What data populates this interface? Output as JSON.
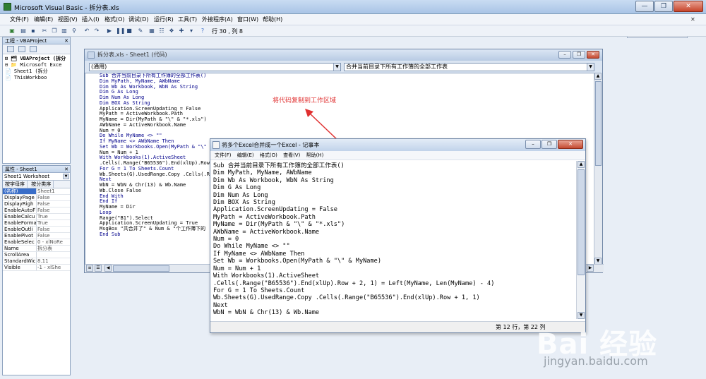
{
  "app": {
    "title": "Microsoft Visual Basic - 拆分表.xls",
    "window_buttons": [
      "—",
      "❐",
      "✕"
    ]
  },
  "menu": {
    "items": [
      "文件(F)",
      "编辑(E)",
      "视图(V)",
      "插入(I)",
      "格式(O)",
      "调试(D)",
      "运行(R)",
      "工具(T)",
      "外接程序(A)",
      "窗口(W)",
      "帮助(H)"
    ],
    "help_placeholder": "键入需要帮助的问题"
  },
  "toolbar": {
    "position": "行 30 , 列 8"
  },
  "project_pane": {
    "title": "工程 - VBAProject",
    "tree": [
      "⊟ 🗂 VBAProject (拆分",
      "  ⊟ 📁 Microsoft Exce",
      "      📄 Sheet1 (拆分",
      "      📄 ThisWorkboo"
    ]
  },
  "properties_pane": {
    "title": "属性 - Sheet1",
    "object": "Sheet1 Worksheet",
    "tabs": [
      "按字母序",
      "按分类序"
    ],
    "rows": [
      {
        "k": "(名称)",
        "v": "Sheet1"
      },
      {
        "k": "DisplayPage",
        "v": "False"
      },
      {
        "k": "DisplayRigh",
        "v": "False"
      },
      {
        "k": "EnableAutoF",
        "v": "False"
      },
      {
        "k": "EnableCalcu",
        "v": "True"
      },
      {
        "k": "EnableForma",
        "v": "True"
      },
      {
        "k": "EnableOutli",
        "v": "False"
      },
      {
        "k": "EnablePivot",
        "v": "False"
      },
      {
        "k": "EnableSelec",
        "v": "0 - xlNoRe"
      },
      {
        "k": "Name",
        "v": "拆分表"
      },
      {
        "k": "ScrollArea",
        "v": ""
      },
      {
        "k": "StandardWic",
        "v": "8.11"
      },
      {
        "k": "Visible",
        "v": "-1 - xlShe"
      }
    ]
  },
  "code_window": {
    "title": "拆分表.xls - Sheet1 (代码)",
    "object_combo": "(通用)",
    "proc_combo": "合并当前目录下所有工作簿的全部工作表",
    "lines": [
      "Sub 合并当前目录下所有工作簿的全部工作表()",
      "Dim MyPath, MyName, AWbName",
      "Dim Wb As Workbook, WbN As String",
      "Dim G As Long",
      "Dim Num As Long",
      "Dim BOX As String",
      "Application.ScreenUpdating = False",
      "MyPath = ActiveWorkbook.Path",
      "MyName = Dir(MyPath & \"\\\" & \"*.xls\")",
      "AWbName = ActiveWorkbook.Name",
      "Num = 0",
      "Do While MyName <> \"\"",
      "If MyName <> AWbName Then",
      "Set Wb = Workbooks.Open(MyPath & \"\\\" &",
      "Num = Num + 1",
      "With Workbooks(1).ActiveSheet",
      ".Cells(.Range(\"B65536\").End(xlUp).Row",
      "For G = 1 To Sheets.Count",
      "Wb.Sheets(G).UsedRange.Copy .Cells(.R",
      "Next",
      "WbN = WbN & Chr(13) & Wb.Name",
      "Wb.Close False",
      "End With",
      "End If",
      "MyName = Dir",
      "Loop",
      "Range(\"B1\").Select",
      "Application.ScreenUpdating = True",
      "MsgBox \"共合并了\" & Num & \"个工作薄下的",
      "End Sub"
    ]
  },
  "annotation": "将代码复制到工作区域",
  "notepad": {
    "title": "将多个Excel合并成一个Excel - 记事本",
    "menu": [
      "文件(F)",
      "编辑(E)",
      "格式(O)",
      "查看(V)",
      "帮助(H)"
    ],
    "lines": [
      "Sub 合并当前目录下所有工作簿的全部工作表()",
      "Dim MyPath, MyName, AWbName",
      "Dim Wb As Workbook, WbN As String",
      "Dim G As Long",
      "Dim Num As Long",
      "Dim BOX As String",
      "Application.ScreenUpdating = False",
      "MyPath = ActiveWorkbook.Path",
      "MyName = Dir(MyPath & \"\\\" & \"*.xls\")",
      "AWbName = ActiveWorkbook.Name",
      "Num = 0",
      "Do While MyName <> \"\"",
      "If MyName <> AWbName Then",
      "Set Wb = Workbooks.Open(MyPath & \"\\\" & MyName)",
      "Num = Num + 1",
      "With Workbooks(1).ActiveSheet",
      ".Cells(.Range(\"B65536\").End(xlUp).Row + 2, 1) = Left(MyName, Len(MyName) - 4)",
      "For G = 1 To Sheets.Count",
      "Wb.Sheets(G).UsedRange.Copy .Cells(.Range(\"B65536\").End(xlUp).Row + 1, 1)",
      "Next",
      "WbN = WbN & Chr(13) & Wb.Name"
    ],
    "status": "第 12 行，第 22 列"
  },
  "watermark": {
    "logo": "Bai 经验",
    "url": "jingyan.baidu.com"
  },
  "colors": {
    "keyword": "#00008b",
    "annotation": "#e03030",
    "selection": "#3a6ec8"
  }
}
